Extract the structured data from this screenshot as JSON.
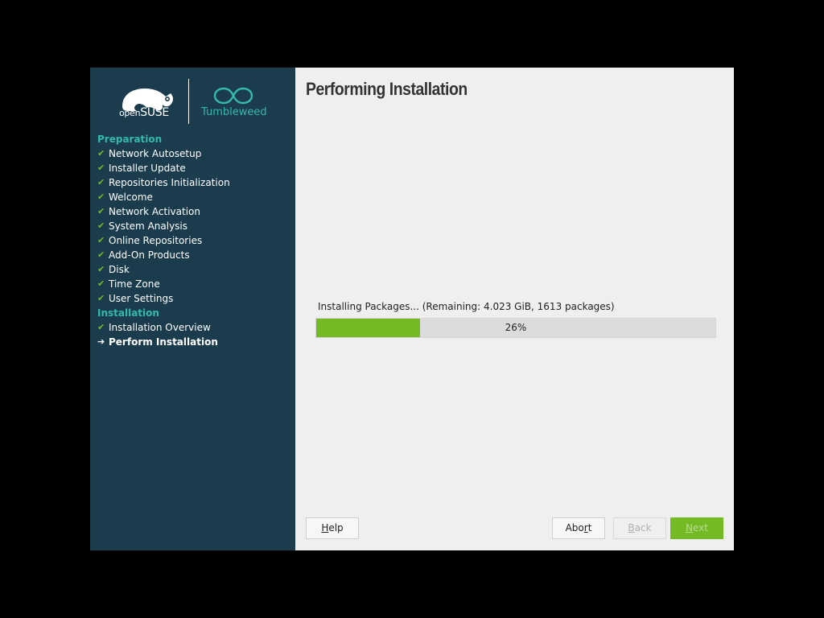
{
  "branding": {
    "opensuse_open": "open",
    "opensuse_suse": "SUSE",
    "tumbleweed": "Tumbleweed"
  },
  "sidebar": {
    "sections": [
      {
        "heading": "Preparation",
        "steps": [
          {
            "label": "Network Autosetup",
            "state": "done"
          },
          {
            "label": "Installer Update",
            "state": "done"
          },
          {
            "label": "Repositories Initialization",
            "state": "done"
          },
          {
            "label": "Welcome",
            "state": "done"
          },
          {
            "label": "Network Activation",
            "state": "done"
          },
          {
            "label": "System Analysis",
            "state": "done"
          },
          {
            "label": "Online Repositories",
            "state": "done"
          },
          {
            "label": "Add-On Products",
            "state": "done"
          },
          {
            "label": "Disk",
            "state": "done"
          },
          {
            "label": "Time Zone",
            "state": "done"
          },
          {
            "label": "User Settings",
            "state": "done"
          }
        ]
      },
      {
        "heading": "Installation",
        "steps": [
          {
            "label": "Installation Overview",
            "state": "done"
          },
          {
            "label": "Perform Installation",
            "state": "current"
          }
        ]
      }
    ],
    "done_mark": "✔",
    "current_mark": "➔"
  },
  "main": {
    "title": "Performing Installation",
    "progress_label": "Installing Packages... (Remaining: 4.023 GiB, 1613 packages)",
    "progress_percent": 26,
    "progress_text": "26%"
  },
  "buttons": {
    "help": {
      "pre": "",
      "ul": "H",
      "post": "elp"
    },
    "abort": {
      "pre": "Abo",
      "ul": "r",
      "post": "t"
    },
    "back": {
      "pre": "",
      "ul": "B",
      "post": "ack"
    },
    "next": {
      "pre": "",
      "ul": "N",
      "post": "ext"
    }
  },
  "colors": {
    "sidebar_bg": "#1b3c4d",
    "accent_teal": "#35b9ab",
    "accent_green": "#73ba25",
    "content_bg": "#efefef"
  }
}
